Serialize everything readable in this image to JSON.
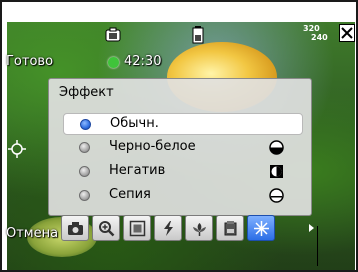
{
  "status": {
    "ready_label": "Готово",
    "timer": "42:30",
    "resolution_top": "320",
    "resolution_bottom": "240"
  },
  "effect_menu": {
    "title": "Эффект",
    "options": [
      {
        "label": "Обычн.",
        "selected": true,
        "icon": null
      },
      {
        "label": "Черно-белое",
        "selected": false,
        "icon": "black-white-circle-icon"
      },
      {
        "label": "Негатив",
        "selected": false,
        "icon": "negative-square-icon"
      },
      {
        "label": "Сепия",
        "selected": false,
        "icon": "sepia-circle-icon"
      }
    ]
  },
  "bottom": {
    "cancel_label": "Отмена"
  },
  "toolbar": {
    "buttons": [
      {
        "icon": "camera-icon",
        "active": false
      },
      {
        "icon": "zoom-icon",
        "active": false
      },
      {
        "icon": "frame-icon",
        "active": false
      },
      {
        "icon": "flash-icon",
        "active": false
      },
      {
        "icon": "macro-icon",
        "active": false
      },
      {
        "icon": "brightness-icon",
        "active": false
      },
      {
        "icon": "effect-icon",
        "active": true
      }
    ]
  },
  "colors": {
    "selected_radio": "#2f6ee0",
    "active_tool": "#2c6ee6",
    "record_indicator": "#3fc43a"
  }
}
